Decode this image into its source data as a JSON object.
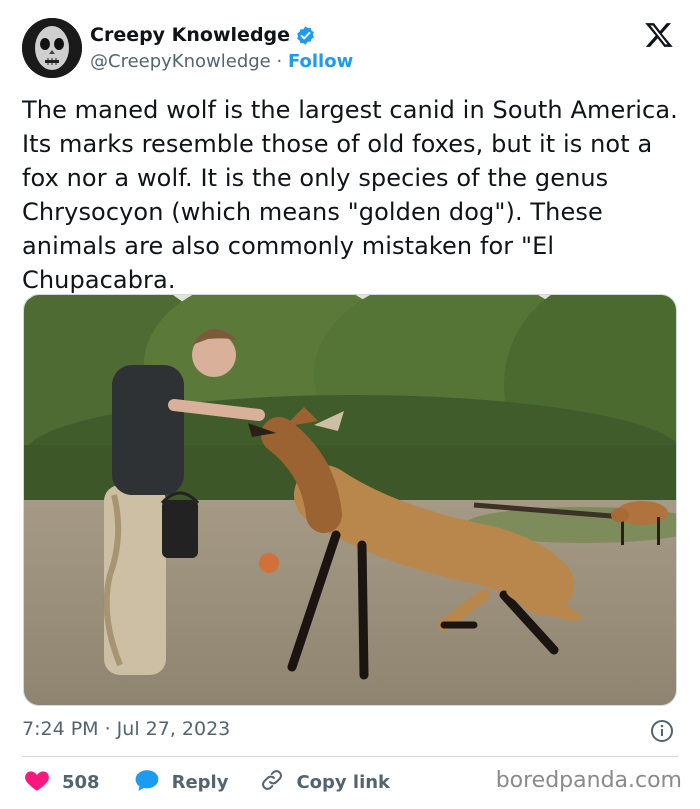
{
  "author": {
    "display_name": "Creepy Knowledge",
    "handle": "@CreepyKnowledge",
    "separator": "·",
    "follow_label": "Follow",
    "verified": true
  },
  "tweet": {
    "text": "The maned wolf is the largest canid in South America. Its marks resemble those of old foxes, but it is not a fox nor a wolf. It is the only species of the genus Chrysocyon (which means \"golden dog\"). These animals are also commonly mistaken for \"El Chupacabra.",
    "timestamp": "7:24 PM · Jul 27, 2023"
  },
  "actions": {
    "like_count": "508",
    "reply_label": "Reply",
    "copy_link_label": "Copy link"
  },
  "watermark": "boredpanda.com",
  "colors": {
    "text": "#0f1419",
    "secondary": "#536471",
    "accent": "#1d9bf0",
    "like": "#f91880",
    "divider": "#cfd9de"
  },
  "icons": [
    "verified-badge-icon",
    "x-logo-icon",
    "info-icon",
    "heart-icon",
    "reply-bubble-icon",
    "link-icon"
  ]
}
